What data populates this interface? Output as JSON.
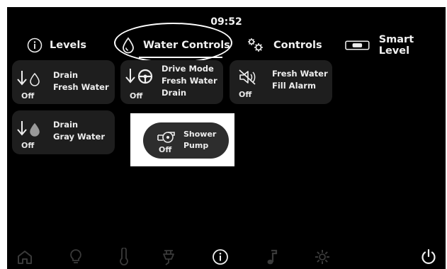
{
  "status": {
    "time": "09:52"
  },
  "tabs": [
    {
      "label": "Levels",
      "icon": "info-icon",
      "selected": false
    },
    {
      "label": "Water Controls",
      "icon": "water-drop-icon",
      "selected": true
    },
    {
      "label": "Controls",
      "icon": "gears-icon",
      "selected": false
    },
    {
      "label": "Smart Level",
      "icon": "level-indicator-icon",
      "selected": false
    }
  ],
  "controls": [
    {
      "line1": "Drain",
      "line2": "Fresh Water",
      "line3": "",
      "state": "Off",
      "icon": "drain-fresh-water-icon"
    },
    {
      "line1": "Drive Mode",
      "line2": "Fresh Water",
      "line3": "Drain",
      "state": "Off",
      "icon": "drive-mode-drain-icon"
    },
    {
      "line1": "Fresh Water",
      "line2": "Fill Alarm",
      "line3": "",
      "state": "Off",
      "icon": "alarm-muted-icon"
    },
    {
      "line1": "Drain",
      "line2": "Gray Water",
      "line3": "",
      "state": "Off",
      "icon": "drain-gray-water-icon"
    },
    {
      "line1": "Shower",
      "line2": "Pump",
      "line3": "",
      "state": "Off",
      "icon": "pump-icon",
      "highlighted": true
    }
  ],
  "bottom_nav": [
    {
      "icon": "home-icon",
      "active": false
    },
    {
      "icon": "lightbulb-icon",
      "active": false
    },
    {
      "icon": "thermometer-icon",
      "active": false
    },
    {
      "icon": "power-plug-icon",
      "active": false
    },
    {
      "icon": "info-icon",
      "active": true
    },
    {
      "icon": "music-note-icon",
      "active": false
    },
    {
      "icon": "settings-icon",
      "active": false
    },
    {
      "icon": "power-icon",
      "active": true
    }
  ],
  "colors": {
    "background": "#000000",
    "tile": "#1e1e1e",
    "text": "#f0f0f0",
    "inactive_icon": "#3a3a3a",
    "highlight": "#ffffff"
  }
}
